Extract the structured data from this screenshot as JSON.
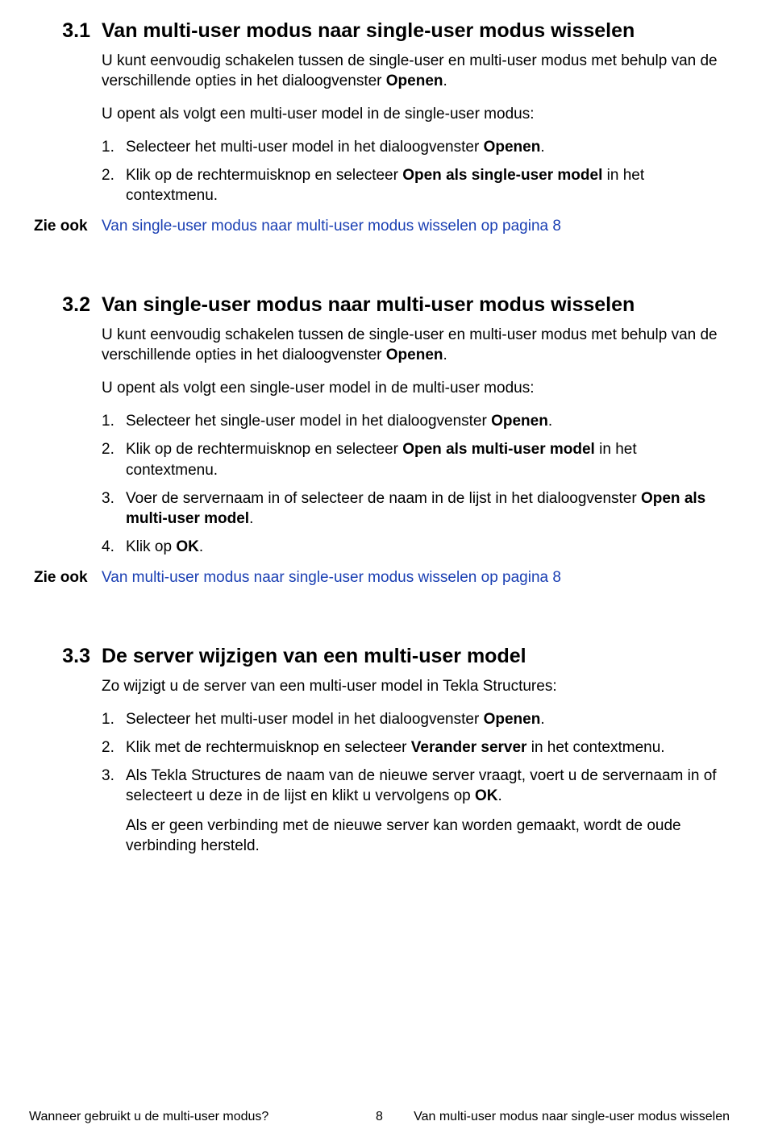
{
  "sections": [
    {
      "num": "3.1",
      "title": "Van multi-user modus naar single-user modus wisselen",
      "intro_html": "U kunt eenvoudig schakelen tussen de single-user en multi-user modus met behulp van de verschillende opties in het dialoogvenster <b>Openen</b>.",
      "lead": "U opent als volgt een multi-user model in de single-user modus:",
      "items": [
        {
          "num": "1.",
          "html": "Selecteer het multi-user model in het dialoogvenster <b>Openen</b>."
        },
        {
          "num": "2.",
          "html": "Klik op de rechtermuisknop en selecteer <b>Open als single-user model</b> in het contextmenu."
        }
      ],
      "seealso_label": "Zie ook",
      "seealso_link": "Van single-user modus naar multi-user modus wisselen op pagina 8"
    },
    {
      "num": "3.2",
      "title": "Van single-user modus naar multi-user modus wisselen",
      "intro_html": "U kunt eenvoudig schakelen tussen de single-user en multi-user modus met behulp van de verschillende opties in het dialoogvenster <b>Openen</b>.",
      "lead": "U opent als volgt een single-user model in de multi-user modus:",
      "items": [
        {
          "num": "1.",
          "html": "Selecteer het single-user model in het dialoogvenster <b>Openen</b>."
        },
        {
          "num": "2.",
          "html": "Klik op de rechtermuisknop en selecteer <b>Open als multi-user model</b> in het contextmenu."
        },
        {
          "num": "3.",
          "html": "Voer de servernaam in of selecteer de naam in de lijst in het dialoogvenster <b>Open als multi-user model</b>."
        },
        {
          "num": "4.",
          "html": "Klik op <b>OK</b>."
        }
      ],
      "seealso_label": "Zie ook",
      "seealso_link": "Van multi-user modus naar single-user modus wisselen op pagina 8"
    },
    {
      "num": "3.3",
      "title": "De server wijzigen van een multi-user model",
      "lead": "Zo wijzigt u de server van een multi-user model in Tekla Structures:",
      "items": [
        {
          "num": "1.",
          "html": "Selecteer het multi-user model in het dialoogvenster <b>Openen</b>."
        },
        {
          "num": "2.",
          "html": "Klik met de rechtermuisknop en selecteer <b>Verander server</b> in het contextmenu."
        },
        {
          "num": "3.",
          "html": "Als Tekla Structures de naam van de nieuwe server vraagt, voert u de servernaam in of selecteert u deze in de lijst en klikt u vervolgens op <b>OK</b>.",
          "extra_html": "Als er geen verbinding met de nieuwe server kan worden gemaakt, wordt de oude verbinding hersteld."
        }
      ]
    }
  ],
  "footer": {
    "left": "Wanneer gebruikt u de multi-user modus?",
    "center": "8",
    "right": "Van multi-user modus naar single-user modus wisselen"
  }
}
